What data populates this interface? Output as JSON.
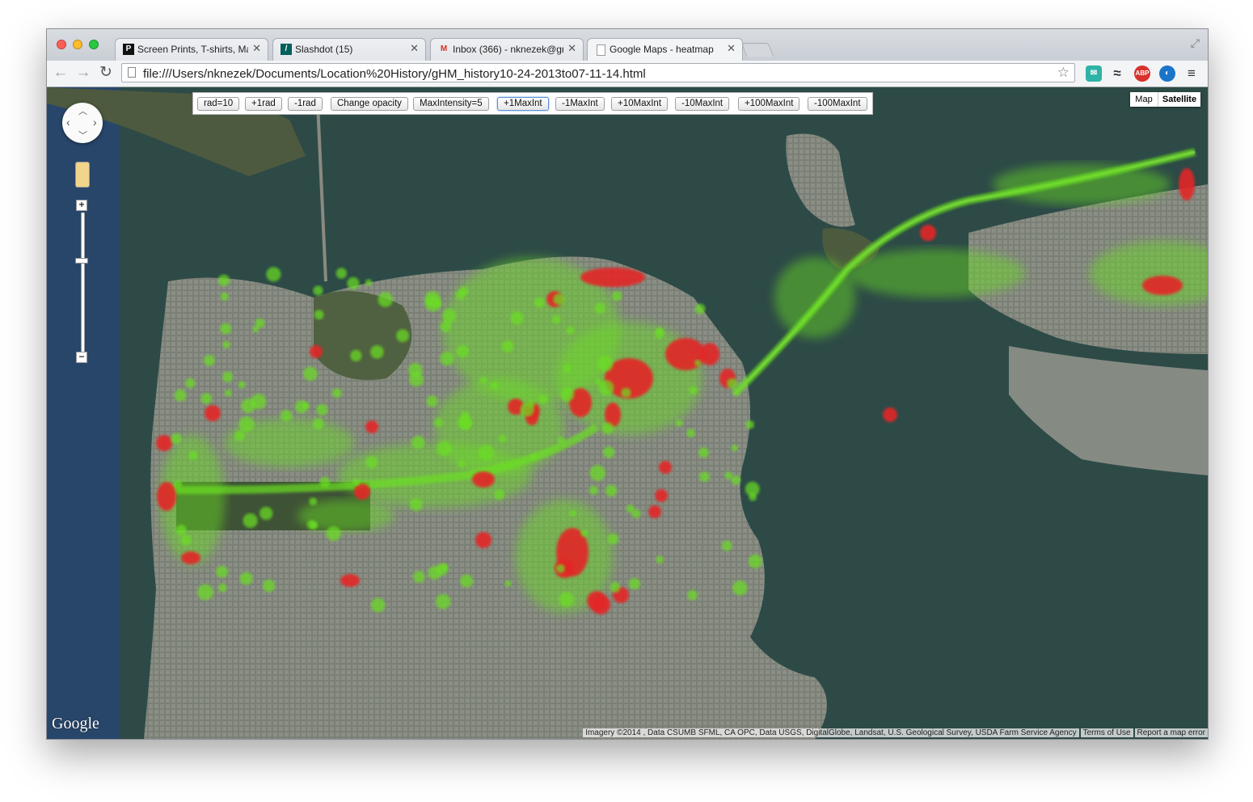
{
  "browser": {
    "tabs": [
      {
        "label": "Screen Prints, T-shirts, Ma",
        "icon": "threadless-favicon-icon",
        "active": false
      },
      {
        "label": "Slashdot (15)",
        "icon": "slashdot-favicon-icon",
        "active": false
      },
      {
        "label": "Inbox (366) - nknezek@gn",
        "icon": "gmail-favicon-icon",
        "active": false
      },
      {
        "label": "Google Maps - heatmap",
        "icon": "page-favicon-icon",
        "active": true
      }
    ],
    "address": "file:///Users/nknezek/Documents/Location%20History/gHM_history10-24-2013to07-11-14.html",
    "extensions": [
      "evernote-icon",
      "approximately-icon",
      "adblock-plus-icon",
      "eye-extension-icon",
      "menu-icon"
    ],
    "adblock_label": "ABP"
  },
  "controls": {
    "buttons": [
      "rad=10",
      "+1rad",
      "-1rad",
      "Change opacity",
      "MaxIntensity=5",
      "+1MaxInt",
      "-1MaxInt",
      "+10MaxInt",
      "-10MaxInt",
      "+100MaxInt",
      "-100MaxInt"
    ],
    "map_type": {
      "map": "Map",
      "satellite": "Satellite",
      "selected": "Satellite"
    }
  },
  "map": {
    "logo": "Google",
    "attribution": "Imagery ©2014 , Data CSUMB SFML, CA OPC, Data USGS, DigitalGlobe, Landsat, U.S. Geological Survey, USDA Farm Service Agency",
    "terms": "Terms of Use",
    "report": "Report a map error",
    "colors": {
      "water": "#2e4a47",
      "land": "#7e8478",
      "heat_low": "#6be021",
      "heat_high": "#e32828"
    }
  }
}
